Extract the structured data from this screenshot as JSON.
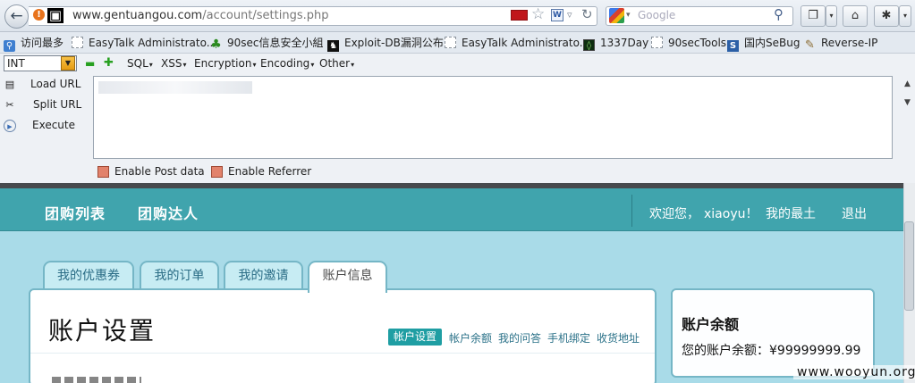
{
  "browser": {
    "url_host": "www.gentuangou.com",
    "url_path": "/account/settings.php",
    "search_placeholder": "Google"
  },
  "bookmarks": [
    {
      "label": "访问最多",
      "icon": "magnifier-icon"
    },
    {
      "label": "EasyTalk Administrato...",
      "icon": "page-icon"
    },
    {
      "label": "90sec信息安全小組",
      "icon": "leaf-icon"
    },
    {
      "label": "Exploit-DB漏洞公布",
      "icon": "exploit-icon"
    },
    {
      "label": "EasyTalk Administrato...",
      "icon": "page-icon"
    },
    {
      "label": "1337Day",
      "icon": "1337-icon"
    },
    {
      "label": "90secTools",
      "icon": "page-icon"
    },
    {
      "label": "国内SeBug",
      "icon": "sebug-icon"
    },
    {
      "label": "Reverse-IP",
      "icon": "pen-icon"
    }
  ],
  "hackbar": {
    "type_select": "INT",
    "menus": [
      "SQL",
      "XSS",
      "Encryption",
      "Encoding",
      "Other"
    ],
    "actions": [
      {
        "label": "Load URL",
        "icon": "load-url-icon"
      },
      {
        "label": "Split URL",
        "icon": "scissors-icon"
      },
      {
        "label": "Execute",
        "icon": "play-icon"
      }
    ],
    "enable_post": "Enable Post data",
    "enable_referrer": "Enable Referrer"
  },
  "site": {
    "nav_left": [
      "团购列表",
      "团购达人"
    ],
    "welcome": "欢迎您，",
    "username": "xiaoyu！",
    "my_home": "我的最土",
    "logout": "退出",
    "tabs": [
      "我的优惠券",
      "我的订单",
      "我的邀请",
      "账户信息"
    ],
    "active_tab": "账户信息",
    "panel_title": "账户设置",
    "sub_links": [
      "帐户设置",
      "帐户余额",
      "我的问答",
      "手机绑定",
      "收货地址"
    ],
    "balance_title": "账户余额",
    "balance_text": "您的账户余额：¥99999999.99"
  },
  "watermark": "www.wooyun.org",
  "colors": {
    "accent": "#40a4ad",
    "page_bg": "#a9dbe8",
    "active_sublink": "#1f9ea3"
  }
}
